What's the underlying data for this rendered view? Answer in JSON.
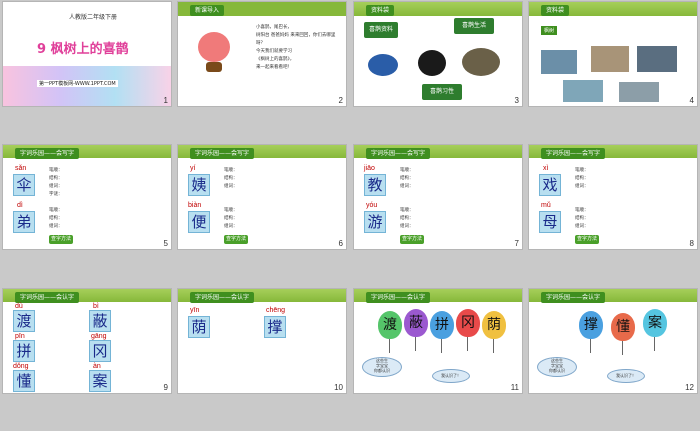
{
  "slides": [
    {
      "num": "1",
      "subtitle": "人教版二年级下册",
      "title": "9  枫树上的喜鹊",
      "footer": "第一PPT模板网-WWW.1PPT.COM"
    },
    {
      "num": "2",
      "tag": "新课导入",
      "poem": [
        "小喜鹊，尾巴长，",
        "树阳台 爸爸妈妈 来来回回，你们去哪里呀？",
        "今天我们就要学习",
        "《枫树上的喜鹊》，",
        "来一起来看看吧！"
      ]
    },
    {
      "num": "3",
      "tag": "资料袋",
      "labels": [
        "喜鹊资料",
        "喜鹊生活",
        "喜鹊习性"
      ]
    },
    {
      "num": "4",
      "tag": "资料袋",
      "label": "枫树"
    },
    {
      "num": "5",
      "tag": "字词乐园——会写字",
      "chars": [
        {
          "py": "sǎn",
          "ch": "伞"
        },
        {
          "py": "dì",
          "ch": "弟"
        }
      ],
      "btn": "查字方法",
      "lines": [
        "笔顺：",
        "结构：",
        "组词：",
        "字谜：",
        "易错提示：",
        "笔顺：",
        "结构：",
        "组词："
      ]
    },
    {
      "num": "6",
      "tag": "字词乐园——会写字",
      "chars": [
        {
          "py": "yí",
          "ch": "姨"
        },
        {
          "py": "biàn",
          "ch": "便"
        }
      ],
      "btn": "查字方法",
      "lines": [
        "笔顺：",
        "结构：",
        "组词：",
        "笔顺：",
        "结构：",
        "组词："
      ]
    },
    {
      "num": "7",
      "tag": "字词乐园——会写字",
      "chars": [
        {
          "py": "jiāo",
          "ch": "教"
        },
        {
          "py": "yóu",
          "ch": "游"
        }
      ],
      "btn": "查字方法",
      "lines": [
        "笔顺：",
        "结构：",
        "组词：",
        "笔顺：",
        "结构：",
        "组词："
      ]
    },
    {
      "num": "8",
      "tag": "字词乐园——会写字",
      "chars": [
        {
          "py": "xì",
          "ch": "戏"
        },
        {
          "py": "mǔ",
          "ch": "母"
        }
      ],
      "btn": "查字方法",
      "lines": [
        "笔顺：",
        "结构：",
        "组词：",
        "笔顺：",
        "结构：",
        "组词："
      ]
    },
    {
      "num": "9",
      "tag": "字词乐园——会认字",
      "chars": [
        {
          "py": "dù",
          "ch": "渡"
        },
        {
          "py": "bì",
          "ch": "蔽"
        },
        {
          "py": "pīn",
          "ch": "拼"
        },
        {
          "py": "gāng",
          "ch": "冈"
        },
        {
          "py": "dǒng",
          "ch": "懂"
        },
        {
          "py": "àn",
          "ch": "案"
        }
      ]
    },
    {
      "num": "10",
      "tag": "字词乐园——会认字",
      "chars": [
        {
          "py": "yīn",
          "ch": "荫"
        },
        {
          "py": "chēng",
          "ch": "撑"
        }
      ]
    },
    {
      "num": "11",
      "tag": "字词乐园——会认字",
      "balloons": [
        "渡",
        "蔽",
        "拼",
        "冈",
        "荫"
      ],
      "bubble": [
        "这些生",
        "字宝宝",
        "你都认识",
        "吗？"
      ],
      "reply": "我认识了！"
    },
    {
      "num": "12",
      "tag": "字词乐园——会认字",
      "balloons": [
        "撑",
        "懂",
        "案"
      ],
      "bubble": [
        "这些生",
        "字宝宝",
        "你都认识",
        "吗？"
      ],
      "reply": "我认识了！"
    }
  ],
  "colors": {
    "accent": "#3f8f1f",
    "char_blue": "#1a2a8a",
    "pinyin_red": "#c00000"
  }
}
